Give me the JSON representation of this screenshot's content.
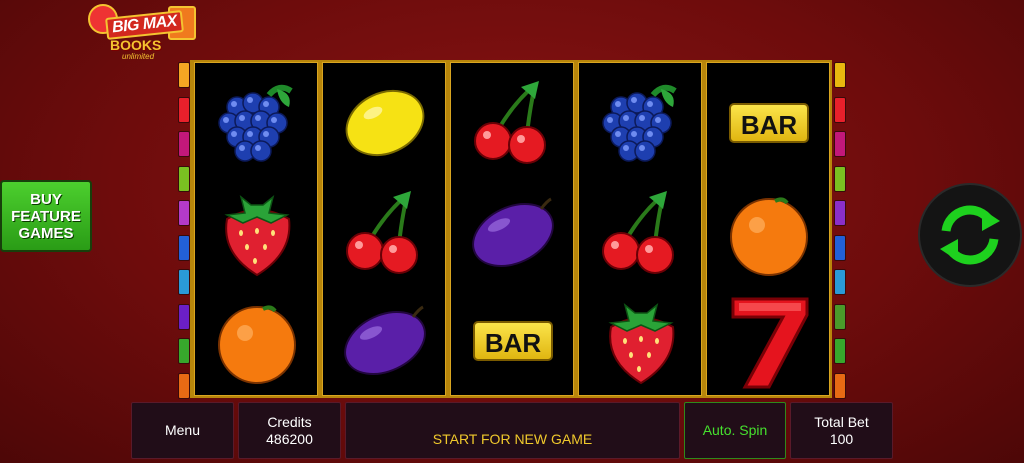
{
  "logo": {
    "line1": "BIG MAX",
    "line2": "BOOKS",
    "line3": "unlimited"
  },
  "buy_feature": {
    "line1": "BUY",
    "line2": "FEATURE",
    "line3": "GAMES"
  },
  "reels": [
    [
      "grapes",
      "strawberry",
      "orange"
    ],
    [
      "lemon",
      "cherries",
      "plum"
    ],
    [
      "cherries",
      "plum",
      "bar"
    ],
    [
      "grapes",
      "cherries",
      "strawberry"
    ],
    [
      "bar",
      "orange",
      "seven"
    ]
  ],
  "bar_label": "BAR",
  "seven_label": "7",
  "controls": {
    "menu": "Menu",
    "credits_label": "Credits",
    "credits_value": "486200",
    "message": "START FOR NEW GAME",
    "auto_spin": "Auto. Spin",
    "total_bet_label": "Total Bet",
    "total_bet_value": "100"
  },
  "icons": {
    "spin": "refresh-arrows-icon"
  },
  "colors": {
    "background": "#7a0f0f",
    "reel_background": "#000000",
    "reel_frame": "#d9a520",
    "accent_green": "#46e02e",
    "message_yellow": "#f0c92c"
  },
  "paylines_left": [
    "#f5a623",
    "#e8202b",
    "#c2187a",
    "#7ac021",
    "#b43ac9",
    "#2260d8",
    "#2a9ad8",
    "#6b1fc6",
    "#37a82c",
    "#e86a14"
  ],
  "paylines_right": [
    "#e8b80f",
    "#e8202b",
    "#c2187a",
    "#7ac021",
    "#8a2fc9",
    "#2260d8",
    "#2a9ad8",
    "#4a9a2a",
    "#37a82c",
    "#e86a14"
  ]
}
